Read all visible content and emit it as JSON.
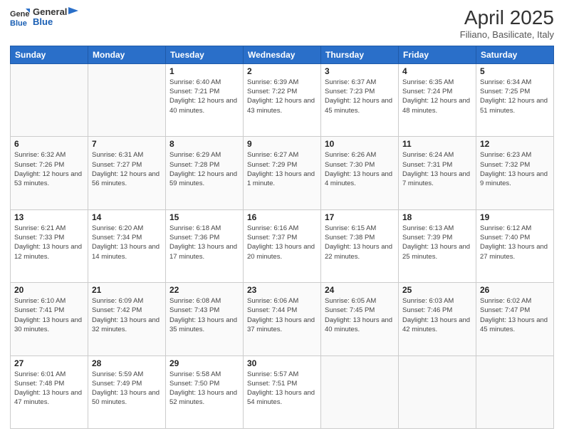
{
  "header": {
    "logo_general": "General",
    "logo_blue": "Blue",
    "main_title": "April 2025",
    "sub_title": "Filiano, Basilicate, Italy"
  },
  "calendar": {
    "days_of_week": [
      "Sunday",
      "Monday",
      "Tuesday",
      "Wednesday",
      "Thursday",
      "Friday",
      "Saturday"
    ],
    "weeks": [
      [
        {
          "day": "",
          "info": ""
        },
        {
          "day": "",
          "info": ""
        },
        {
          "day": "1",
          "sunrise": "Sunrise: 6:40 AM",
          "sunset": "Sunset: 7:21 PM",
          "daylight": "Daylight: 12 hours and 40 minutes."
        },
        {
          "day": "2",
          "sunrise": "Sunrise: 6:39 AM",
          "sunset": "Sunset: 7:22 PM",
          "daylight": "Daylight: 12 hours and 43 minutes."
        },
        {
          "day": "3",
          "sunrise": "Sunrise: 6:37 AM",
          "sunset": "Sunset: 7:23 PM",
          "daylight": "Daylight: 12 hours and 45 minutes."
        },
        {
          "day": "4",
          "sunrise": "Sunrise: 6:35 AM",
          "sunset": "Sunset: 7:24 PM",
          "daylight": "Daylight: 12 hours and 48 minutes."
        },
        {
          "day": "5",
          "sunrise": "Sunrise: 6:34 AM",
          "sunset": "Sunset: 7:25 PM",
          "daylight": "Daylight: 12 hours and 51 minutes."
        }
      ],
      [
        {
          "day": "6",
          "sunrise": "Sunrise: 6:32 AM",
          "sunset": "Sunset: 7:26 PM",
          "daylight": "Daylight: 12 hours and 53 minutes."
        },
        {
          "day": "7",
          "sunrise": "Sunrise: 6:31 AM",
          "sunset": "Sunset: 7:27 PM",
          "daylight": "Daylight: 12 hours and 56 minutes."
        },
        {
          "day": "8",
          "sunrise": "Sunrise: 6:29 AM",
          "sunset": "Sunset: 7:28 PM",
          "daylight": "Daylight: 12 hours and 59 minutes."
        },
        {
          "day": "9",
          "sunrise": "Sunrise: 6:27 AM",
          "sunset": "Sunset: 7:29 PM",
          "daylight": "Daylight: 13 hours and 1 minute."
        },
        {
          "day": "10",
          "sunrise": "Sunrise: 6:26 AM",
          "sunset": "Sunset: 7:30 PM",
          "daylight": "Daylight: 13 hours and 4 minutes."
        },
        {
          "day": "11",
          "sunrise": "Sunrise: 6:24 AM",
          "sunset": "Sunset: 7:31 PM",
          "daylight": "Daylight: 13 hours and 7 minutes."
        },
        {
          "day": "12",
          "sunrise": "Sunrise: 6:23 AM",
          "sunset": "Sunset: 7:32 PM",
          "daylight": "Daylight: 13 hours and 9 minutes."
        }
      ],
      [
        {
          "day": "13",
          "sunrise": "Sunrise: 6:21 AM",
          "sunset": "Sunset: 7:33 PM",
          "daylight": "Daylight: 13 hours and 12 minutes."
        },
        {
          "day": "14",
          "sunrise": "Sunrise: 6:20 AM",
          "sunset": "Sunset: 7:34 PM",
          "daylight": "Daylight: 13 hours and 14 minutes."
        },
        {
          "day": "15",
          "sunrise": "Sunrise: 6:18 AM",
          "sunset": "Sunset: 7:36 PM",
          "daylight": "Daylight: 13 hours and 17 minutes."
        },
        {
          "day": "16",
          "sunrise": "Sunrise: 6:16 AM",
          "sunset": "Sunset: 7:37 PM",
          "daylight": "Daylight: 13 hours and 20 minutes."
        },
        {
          "day": "17",
          "sunrise": "Sunrise: 6:15 AM",
          "sunset": "Sunset: 7:38 PM",
          "daylight": "Daylight: 13 hours and 22 minutes."
        },
        {
          "day": "18",
          "sunrise": "Sunrise: 6:13 AM",
          "sunset": "Sunset: 7:39 PM",
          "daylight": "Daylight: 13 hours and 25 minutes."
        },
        {
          "day": "19",
          "sunrise": "Sunrise: 6:12 AM",
          "sunset": "Sunset: 7:40 PM",
          "daylight": "Daylight: 13 hours and 27 minutes."
        }
      ],
      [
        {
          "day": "20",
          "sunrise": "Sunrise: 6:10 AM",
          "sunset": "Sunset: 7:41 PM",
          "daylight": "Daylight: 13 hours and 30 minutes."
        },
        {
          "day": "21",
          "sunrise": "Sunrise: 6:09 AM",
          "sunset": "Sunset: 7:42 PM",
          "daylight": "Daylight: 13 hours and 32 minutes."
        },
        {
          "day": "22",
          "sunrise": "Sunrise: 6:08 AM",
          "sunset": "Sunset: 7:43 PM",
          "daylight": "Daylight: 13 hours and 35 minutes."
        },
        {
          "day": "23",
          "sunrise": "Sunrise: 6:06 AM",
          "sunset": "Sunset: 7:44 PM",
          "daylight": "Daylight: 13 hours and 37 minutes."
        },
        {
          "day": "24",
          "sunrise": "Sunrise: 6:05 AM",
          "sunset": "Sunset: 7:45 PM",
          "daylight": "Daylight: 13 hours and 40 minutes."
        },
        {
          "day": "25",
          "sunrise": "Sunrise: 6:03 AM",
          "sunset": "Sunset: 7:46 PM",
          "daylight": "Daylight: 13 hours and 42 minutes."
        },
        {
          "day": "26",
          "sunrise": "Sunrise: 6:02 AM",
          "sunset": "Sunset: 7:47 PM",
          "daylight": "Daylight: 13 hours and 45 minutes."
        }
      ],
      [
        {
          "day": "27",
          "sunrise": "Sunrise: 6:01 AM",
          "sunset": "Sunset: 7:48 PM",
          "daylight": "Daylight: 13 hours and 47 minutes."
        },
        {
          "day": "28",
          "sunrise": "Sunrise: 5:59 AM",
          "sunset": "Sunset: 7:49 PM",
          "daylight": "Daylight: 13 hours and 50 minutes."
        },
        {
          "day": "29",
          "sunrise": "Sunrise: 5:58 AM",
          "sunset": "Sunset: 7:50 PM",
          "daylight": "Daylight: 13 hours and 52 minutes."
        },
        {
          "day": "30",
          "sunrise": "Sunrise: 5:57 AM",
          "sunset": "Sunset: 7:51 PM",
          "daylight": "Daylight: 13 hours and 54 minutes."
        },
        {
          "day": "",
          "info": ""
        },
        {
          "day": "",
          "info": ""
        },
        {
          "day": "",
          "info": ""
        }
      ]
    ]
  }
}
